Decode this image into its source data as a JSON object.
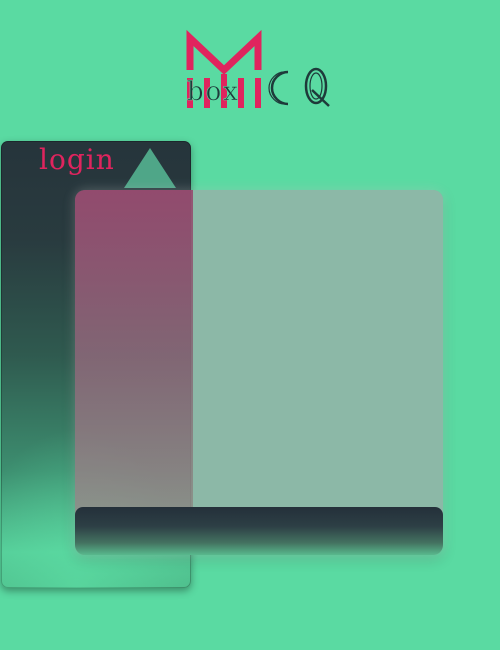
{
  "logo": {
    "text": "box",
    "alt_text": "MboxCQ",
    "colors": {
      "mark": "#e0245e",
      "text": "#1e3a3a"
    }
  },
  "login_panel": {
    "title": "login",
    "toggle_icon": "triangle-up-icon",
    "title_color": "#e0245e"
  },
  "card": {
    "background": "#8cb8a7",
    "footer": ""
  },
  "colors": {
    "page_background": "#5adaa2",
    "panel_dark": "#26343b"
  }
}
